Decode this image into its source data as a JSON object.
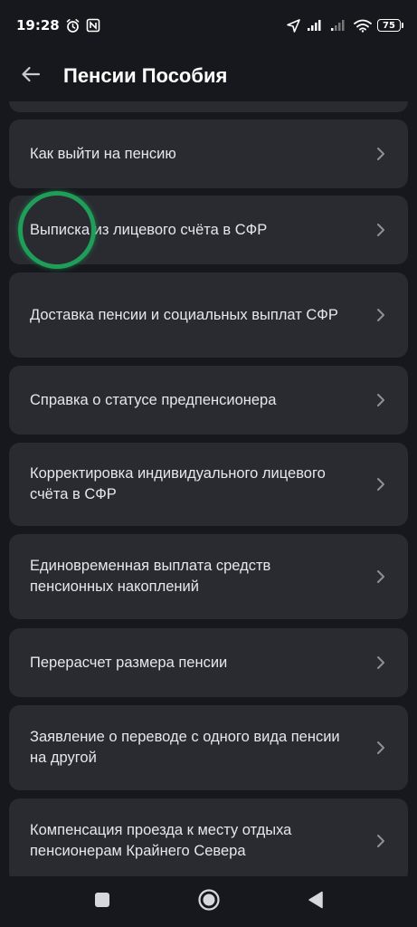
{
  "status_bar": {
    "time": "19:28",
    "battery": "75"
  },
  "app_bar": {
    "title": "Пенсии Пособия"
  },
  "list": {
    "items": [
      {
        "label": "Как выйти на пенсию"
      },
      {
        "label": "Выписка из лицевого счёта в СФР"
      },
      {
        "label": "Доставка пенсии и социальных выплат СФР"
      },
      {
        "label": "Справка о статусе предпенсионера"
      },
      {
        "label": "Корректировка индивидуального лицевого счёта в СФР"
      },
      {
        "label": "Единовременная выплата средств пенсионных накоплений"
      },
      {
        "label": "Перерасчет размера пенсии"
      },
      {
        "label": "Заявление о переводе с одного вида пенсии на другой"
      },
      {
        "label": "Компенсация проезда к месту отдыха пенсионерам Крайнего Севера"
      }
    ]
  },
  "colors": {
    "background": "#17181d",
    "card": "#2a2b31",
    "text": "#e6e7ec",
    "chevron": "#8e9099",
    "touch_indicator": "#1f9e5a"
  },
  "icons": {
    "back": "arrow-left-icon",
    "chevron": "chevron-right-icon",
    "nav_recent": "square-icon",
    "nav_home": "circle-icon",
    "nav_back": "triangle-icon"
  }
}
